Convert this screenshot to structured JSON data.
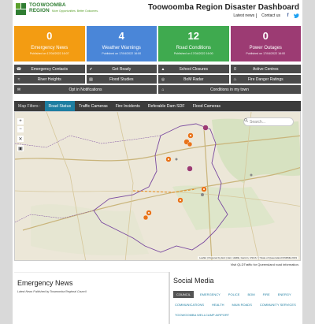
{
  "header": {
    "logo_line1": "TOOWOOMBA",
    "logo_line2": "REGION",
    "logo_tagline": "More Opportunities. Better Outcomes.",
    "title": "Toowoomba Region Disaster Dashboard",
    "links": [
      "Latest news",
      "Contact us"
    ],
    "social_icons": [
      "facebook-icon",
      "twitter-icon"
    ]
  },
  "tiles": [
    {
      "value": "0",
      "label": "Emergency News",
      "published": "Published on 17/04/2022 16:07",
      "color": "#f39c12"
    },
    {
      "value": "4",
      "label": "Weather Warnings",
      "published": "Published on 17/04/2022 16:00",
      "color": "#4a86d8"
    },
    {
      "value": "12",
      "label": "Road Conditions",
      "published": "Published on 17/04/2022 16:00",
      "color": "#3faa4f"
    },
    {
      "value": "0",
      "label": "Power Outages",
      "published": "Published on 17/04/2022 16:00",
      "color": "#9c3b73"
    }
  ],
  "buttons": [
    {
      "label": "Emergency Contacts",
      "icon": "phone-icon",
      "glyph": "☎"
    },
    {
      "label": "Get Ready",
      "icon": "check-icon",
      "glyph": "✔"
    },
    {
      "label": "School Closures",
      "icon": "school-icon",
      "glyph": "▲"
    },
    {
      "label": "Active Centres",
      "icon": "centre-icon",
      "glyph": "0"
    },
    {
      "label": "River Heights",
      "icon": "water-icon",
      "glyph": "≈"
    },
    {
      "label": "Flood Studies",
      "icon": "document-icon",
      "glyph": "▤"
    },
    {
      "label": "BoM Radar",
      "icon": "radar-icon",
      "glyph": "◎"
    },
    {
      "label": "Fire Danger Ratings",
      "icon": "fire-icon",
      "glyph": "♨"
    },
    {
      "label": "Opt in Notifications",
      "icon": "bell-icon",
      "glyph": "✉",
      "wide": true
    },
    {
      "label": "Conditions in my town",
      "icon": "pin-icon",
      "glyph": "⌂",
      "wide": true
    }
  ],
  "map": {
    "filters_label": "Map Filters :",
    "tabs": [
      "Road Status",
      "Traffic Cameras",
      "Fire Incidents",
      "Referable Dam SDF",
      "Flood Cameras"
    ],
    "active_tab": "Road Status",
    "search_placeholder": "Search...",
    "attribution": "Leaflet | Powered by Esri | Esri, HERE, Garmin, USGS, © State of Queensland DNRME 2019",
    "note": "Visit QLDTraffic for Queensland road information."
  },
  "news": {
    "title": "Emergency News",
    "subtitle": "Latest News Published by Toowoomba Regional Council"
  },
  "social": {
    "title": "Social Media",
    "tabs": [
      "COUNCIL",
      "EMERGENCY",
      "POLICE",
      "BOM",
      "FIRE",
      "ENERGY",
      "COMMUNICATIONS",
      "HEALTH",
      "MAIN ROADS",
      "COMMUNITY SERVICES",
      "TOOWOOMBA WELLCAMP AIRPORT"
    ],
    "active_tab": "COUNCIL"
  }
}
